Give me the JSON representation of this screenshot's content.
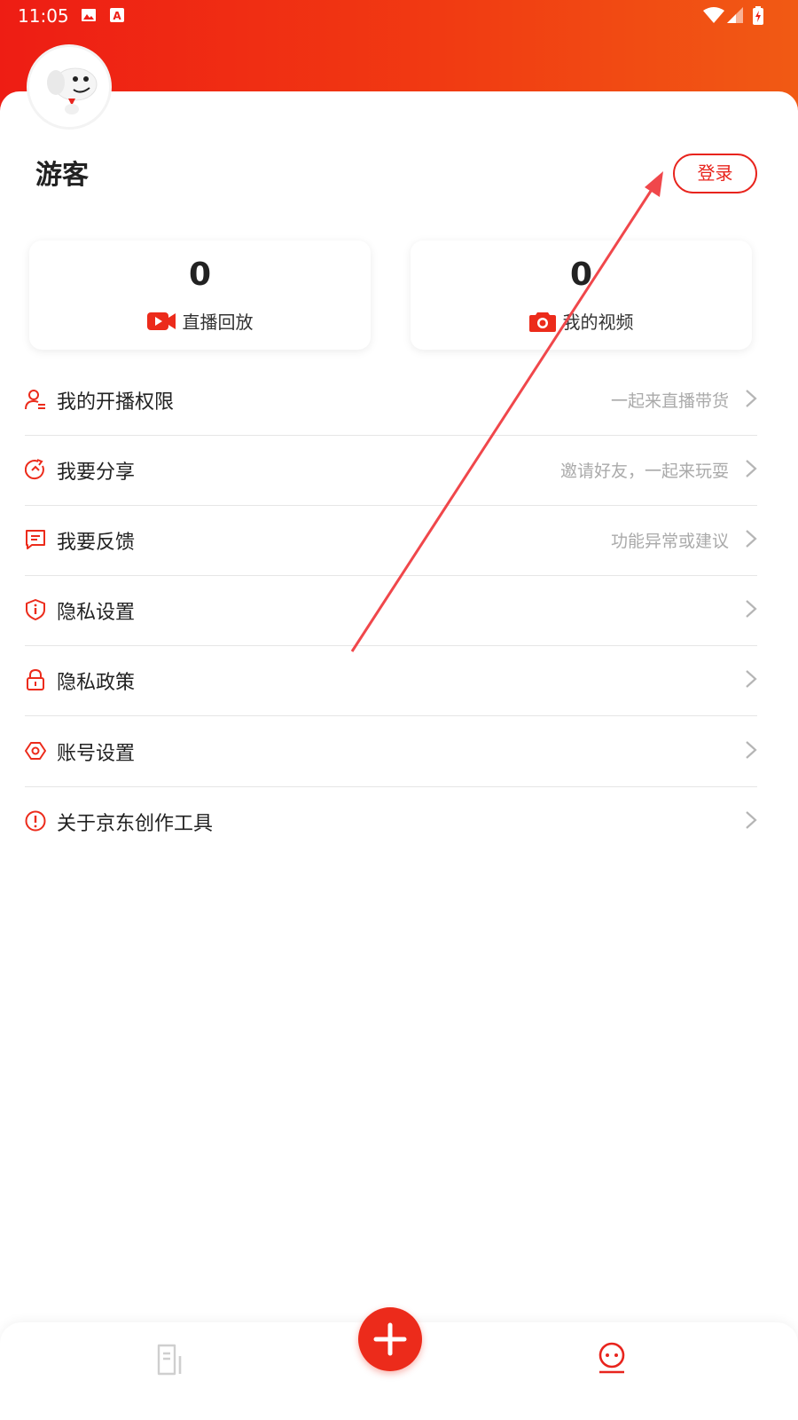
{
  "status_bar": {
    "time": "11:05",
    "icons": [
      "image-icon",
      "a-icon",
      "wifi-icon",
      "signal-icon",
      "battery-charging-icon"
    ]
  },
  "profile": {
    "username": "游客",
    "login_label": "登录",
    "avatar": "jd-dog-mascot-avatar"
  },
  "stats": [
    {
      "value": "0",
      "label": "直播回放",
      "icon": "video-icon"
    },
    {
      "value": "0",
      "label": "我的视频",
      "icon": "camera-icon"
    }
  ],
  "menu": [
    {
      "label": "我的开播权限",
      "sub": "一起来直播带货",
      "icon": "user-permission-icon"
    },
    {
      "label": "我要分享",
      "sub": "邀请好友，一起来玩耍",
      "icon": "share-icon"
    },
    {
      "label": "我要反馈",
      "sub": "功能异常或建议",
      "icon": "feedback-icon"
    },
    {
      "label": "隐私设置",
      "sub": "",
      "icon": "shield-icon"
    },
    {
      "label": "隐私政策",
      "sub": "",
      "icon": "lock-icon"
    },
    {
      "label": "账号设置",
      "sub": "",
      "icon": "account-settings-icon"
    },
    {
      "label": "关于京东创作工具",
      "sub": "",
      "icon": "info-icon"
    }
  ],
  "bottom_nav": {
    "items": [
      "document-icon",
      "plus-icon",
      "profile-icon"
    ],
    "active": "profile-icon"
  },
  "colors": {
    "accent": "#e8241d",
    "header_start": "#ee1d14",
    "header_end": "#f15a14",
    "annotation_arrow": "#f0474b"
  }
}
